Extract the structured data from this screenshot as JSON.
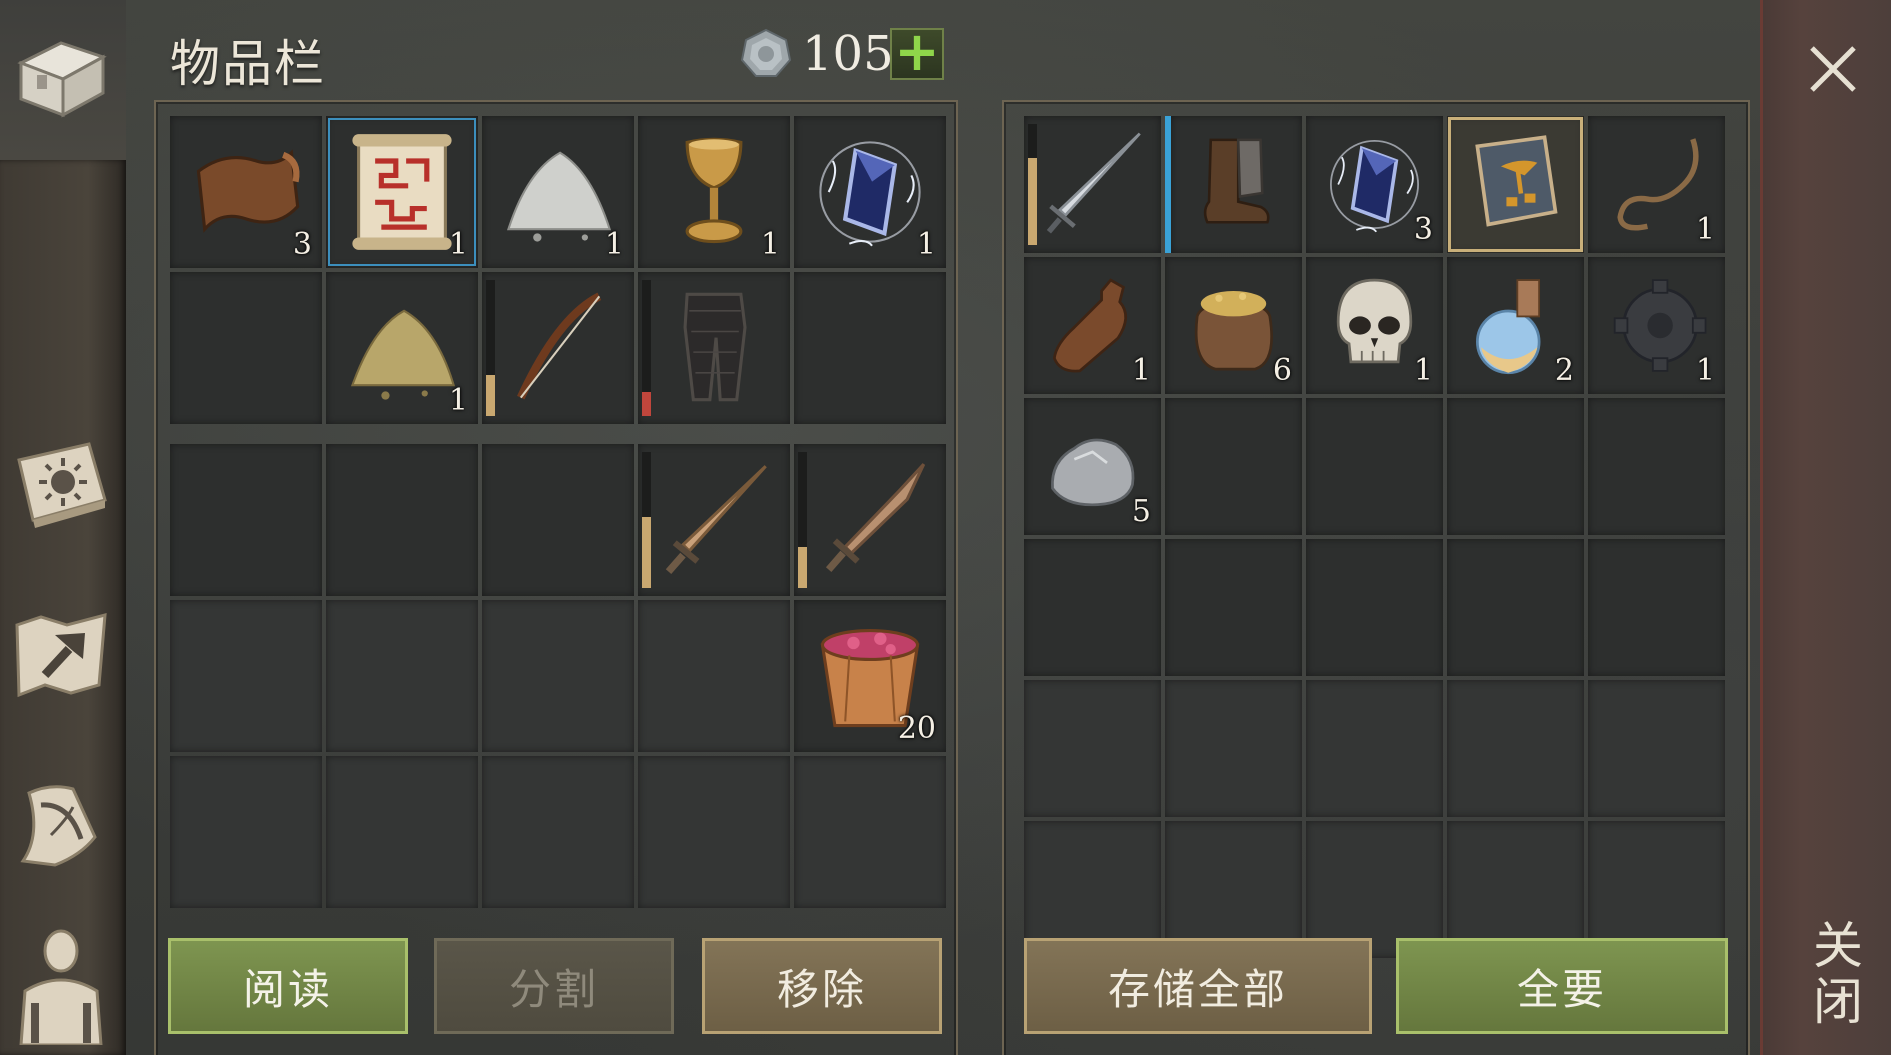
{
  "header": {
    "title": "物品栏",
    "silver_count": "105",
    "add_label": "+"
  },
  "close": {
    "vertical_label": "关闭"
  },
  "sidebar": {
    "tabs": [
      {
        "name": "inventory",
        "icon": "chest-icon"
      },
      {
        "name": "skills",
        "icon": "sun-book-icon"
      },
      {
        "name": "crafting",
        "icon": "hammer-map-icon"
      },
      {
        "name": "quests",
        "icon": "quill-scroll-icon"
      },
      {
        "name": "character",
        "icon": "character-icon"
      }
    ]
  },
  "inventory_left": {
    "rows": [
      [
        {
          "item": "leather",
          "count": "3"
        },
        {
          "item": "red-scroll",
          "count": "1",
          "selected": true
        },
        {
          "item": "salt-pile",
          "count": "1"
        },
        {
          "item": "golden-goblet",
          "count": "1"
        },
        {
          "item": "blue-crystal",
          "count": "1"
        }
      ],
      [
        {
          "item": ""
        },
        {
          "item": "sand-pile",
          "count": "1"
        },
        {
          "item": "bow",
          "durability": 0.3,
          "durability_color": "#c9a870"
        },
        {
          "item": "chain-leggings",
          "durability": 0.18,
          "durability_color": "#c0463c"
        },
        {
          "item": ""
        }
      ],
      [
        {
          "item": ""
        },
        {
          "item": ""
        },
        {
          "item": ""
        },
        {
          "item": "bronze-sword",
          "durability": 0.52,
          "durability_color": "#c9a870"
        },
        {
          "item": "short-sword",
          "durability": 0.3,
          "durability_color": "#c9a870"
        }
      ],
      [
        {
          "item": ""
        },
        {
          "item": ""
        },
        {
          "item": ""
        },
        {
          "item": ""
        },
        {
          "item": "berry-bucket",
          "count": "20"
        }
      ],
      [
        {
          "item": ""
        },
        {
          "item": ""
        },
        {
          "item": ""
        },
        {
          "item": ""
        },
        {
          "item": ""
        }
      ]
    ]
  },
  "storage_right": {
    "rows": [
      [
        {
          "item": "steel-sword",
          "durability": 0.72,
          "durability_color": "#c9a870"
        },
        {
          "item": "leather-boots",
          "highlight": "blue"
        },
        {
          "item": "blue-crystal",
          "count": "3"
        },
        {
          "item": "recipe-book",
          "selected": true
        },
        {
          "item": "rope",
          "count": "1"
        }
      ],
      [
        {
          "item": "leather-flask",
          "count": "1"
        },
        {
          "item": "grain-sack",
          "count": "6"
        },
        {
          "item": "skull",
          "count": "1"
        },
        {
          "item": "potion-flask",
          "count": "2"
        },
        {
          "item": "iron-gears",
          "count": "1"
        }
      ],
      [
        {
          "item": "stone",
          "count": "5"
        },
        {
          "item": ""
        },
        {
          "item": ""
        },
        {
          "item": ""
        },
        {
          "item": ""
        }
      ],
      [
        {
          "item": ""
        },
        {
          "item": ""
        },
        {
          "item": ""
        },
        {
          "item": ""
        },
        {
          "item": ""
        }
      ],
      [
        {
          "item": ""
        },
        {
          "item": ""
        },
        {
          "item": ""
        },
        {
          "item": ""
        },
        {
          "item": ""
        }
      ],
      [
        {
          "item": ""
        },
        {
          "item": ""
        },
        {
          "item": ""
        },
        {
          "item": ""
        },
        {
          "item": ""
        }
      ]
    ]
  },
  "buttons": {
    "read": "阅读",
    "split": "分割",
    "remove": "移除",
    "store_all": "存储全部",
    "take_all": "全要"
  },
  "colors": {
    "accent_green": "#7e9550",
    "tan": "#837457",
    "selection_blue": "#3c8fbd",
    "selection_gold": "#c9b07a",
    "close_strip": "#56423d"
  }
}
